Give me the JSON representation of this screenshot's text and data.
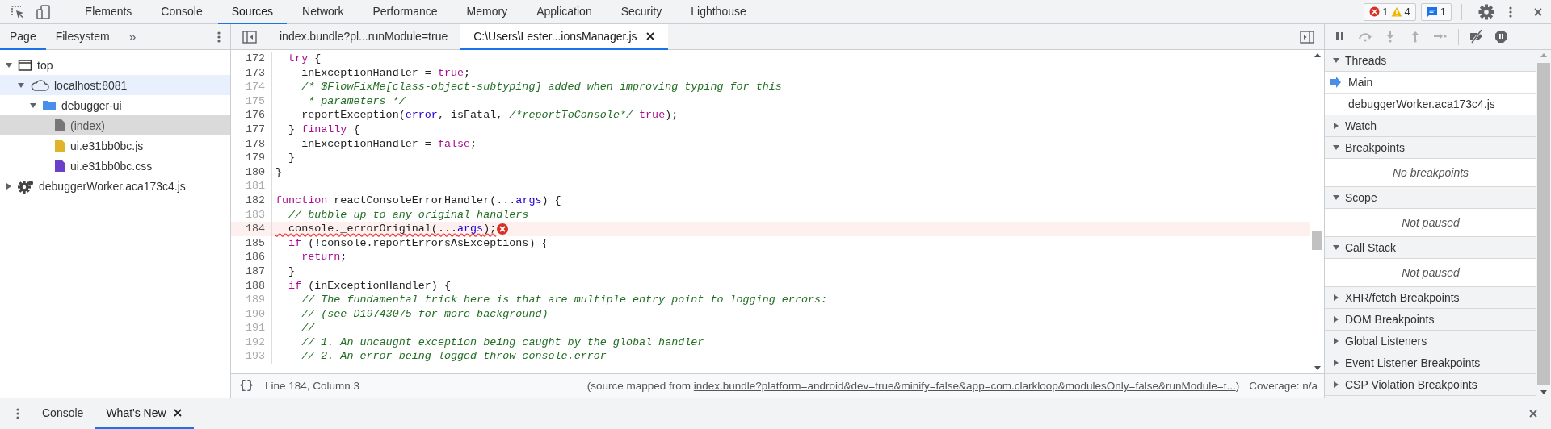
{
  "main_tabs": [
    {
      "label": "Elements",
      "selected": false
    },
    {
      "label": "Console",
      "selected": false
    },
    {
      "label": "Sources",
      "selected": true
    },
    {
      "label": "Network",
      "selected": false
    },
    {
      "label": "Performance",
      "selected": false
    },
    {
      "label": "Memory",
      "selected": false
    },
    {
      "label": "Application",
      "selected": false
    },
    {
      "label": "Security",
      "selected": false
    },
    {
      "label": "Lighthouse",
      "selected": false
    }
  ],
  "issue_counters": {
    "errors": "1",
    "warnings": "4",
    "messages": "1"
  },
  "navigator": {
    "tabs": [
      {
        "label": "Page",
        "selected": true
      },
      {
        "label": "Filesystem",
        "selected": false
      }
    ],
    "more": "»",
    "tree": [
      {
        "label": "top",
        "kind": "frame",
        "expanded": true,
        "selected": false,
        "hovered": false,
        "children": [
          {
            "label": "localhost:8081",
            "kind": "cloud",
            "expanded": true,
            "selected": false,
            "hovered": true,
            "children": [
              {
                "label": "debugger-ui",
                "kind": "folder",
                "expanded": true,
                "selected": false,
                "hovered": false,
                "children": [
                  {
                    "label": "(index)",
                    "kind": "document",
                    "selected": true,
                    "hovered": false
                  },
                  {
                    "label": "ui.e31bb0bc.js",
                    "kind": "script",
                    "selected": false,
                    "hovered": false
                  },
                  {
                    "label": "ui.e31bb0bc.css",
                    "kind": "stylesheet",
                    "selected": false,
                    "hovered": false
                  }
                ]
              }
            ]
          }
        ]
      },
      {
        "label": "debuggerWorker.aca173c4.js",
        "kind": "worker",
        "expanded": false,
        "selected": false,
        "hovered": false
      }
    ]
  },
  "editor": {
    "tabs": [
      {
        "label": "index.bundle?pl...runModule=true",
        "selected": false,
        "closable": false
      },
      {
        "label": "C:\\Users\\Lester...ionsManager.js",
        "selected": true,
        "closable": true
      }
    ],
    "lines": [
      {
        "number": "172",
        "dim": false,
        "error": false,
        "segments": [
          {
            "kind": "keyword",
            "t": "  try"
          },
          {
            "kind": "plain",
            "t": " {"
          }
        ]
      },
      {
        "number": "173",
        "dim": false,
        "error": false,
        "segments": [
          {
            "kind": "plain",
            "t": "    inExceptionHandler = "
          },
          {
            "kind": "keyword",
            "t": "true"
          },
          {
            "kind": "plain",
            "t": ";"
          }
        ]
      },
      {
        "number": "174",
        "dim": true,
        "error": false,
        "segments": [
          {
            "kind": "comment",
            "t": "    /* $FlowFixMe[class-object-subtyping] added when improving typing for this"
          }
        ]
      },
      {
        "number": "175",
        "dim": true,
        "error": false,
        "segments": [
          {
            "kind": "comment",
            "t": "     * parameters */"
          }
        ]
      },
      {
        "number": "176",
        "dim": false,
        "error": false,
        "segments": [
          {
            "kind": "plain",
            "t": "    reportException("
          },
          {
            "kind": "variable",
            "t": "error"
          },
          {
            "kind": "plain",
            "t": ", isFatal, "
          },
          {
            "kind": "comment",
            "t": "/*reportToConsole*/"
          },
          {
            "kind": "keyword",
            "t": " true"
          },
          {
            "kind": "plain",
            "t": ");"
          }
        ]
      },
      {
        "number": "177",
        "dim": false,
        "error": false,
        "segments": [
          {
            "kind": "plain",
            "t": "  } "
          },
          {
            "kind": "keyword",
            "t": "finally"
          },
          {
            "kind": "plain",
            "t": " {"
          }
        ]
      },
      {
        "number": "178",
        "dim": false,
        "error": false,
        "segments": [
          {
            "kind": "plain",
            "t": "    inExceptionHandler = "
          },
          {
            "kind": "keyword",
            "t": "false"
          },
          {
            "kind": "plain",
            "t": ";"
          }
        ]
      },
      {
        "number": "179",
        "dim": false,
        "error": false,
        "segments": [
          {
            "kind": "plain",
            "t": "  }"
          }
        ]
      },
      {
        "number": "180",
        "dim": false,
        "error": false,
        "segments": [
          {
            "kind": "plain",
            "t": "}"
          }
        ]
      },
      {
        "number": "181",
        "dim": true,
        "error": false
      },
      {
        "number": "182",
        "dim": false,
        "error": false,
        "segments": [
          {
            "kind": "keyword",
            "t": "function"
          },
          {
            "kind": "plain",
            "t": " reactConsoleErrorHandler(..."
          },
          {
            "kind": "variable",
            "t": "args"
          },
          {
            "kind": "plain",
            "t": ") {"
          }
        ]
      },
      {
        "number": "183",
        "dim": true,
        "error": false,
        "segments": [
          {
            "kind": "comment",
            "t": "  // bubble up to any original handlers"
          }
        ]
      },
      {
        "number": "184",
        "dim": false,
        "error": true,
        "segments": [
          {
            "kind": "plain",
            "t": "  console._errorOriginal(..."
          },
          {
            "kind": "variable",
            "t": "args"
          },
          {
            "kind": "plain",
            "t": ");"
          }
        ]
      },
      {
        "number": "185",
        "dim": false,
        "error": false,
        "segments": [
          {
            "kind": "keyword",
            "t": "  if"
          },
          {
            "kind": "plain",
            "t": " (!console.reportErrorsAsExceptions) {"
          }
        ]
      },
      {
        "number": "186",
        "dim": false,
        "error": false,
        "segments": [
          {
            "kind": "keyword",
            "t": "    return"
          },
          {
            "kind": "plain",
            "t": ";"
          }
        ]
      },
      {
        "number": "187",
        "dim": false,
        "error": false,
        "segments": [
          {
            "kind": "plain",
            "t": "  }"
          }
        ]
      },
      {
        "number": "188",
        "dim": false,
        "error": false,
        "segments": [
          {
            "kind": "keyword",
            "t": "  if"
          },
          {
            "kind": "plain",
            "t": " (inExceptionHandler) {"
          }
        ]
      },
      {
        "number": "189",
        "dim": true,
        "error": false,
        "segments": [
          {
            "kind": "comment",
            "t": "    // The fundamental trick here is that are multiple entry point to logging errors:"
          }
        ]
      },
      {
        "number": "190",
        "dim": true,
        "error": false,
        "segments": [
          {
            "kind": "comment",
            "t": "    // (see D19743075 for more background)"
          }
        ]
      },
      {
        "number": "191",
        "dim": true,
        "error": false,
        "segments": [
          {
            "kind": "comment",
            "t": "    //"
          }
        ]
      },
      {
        "number": "192",
        "dim": true,
        "error": false,
        "segments": [
          {
            "kind": "comment",
            "t": "    // 1. An uncaught exception being caught by the global handler"
          }
        ]
      },
      {
        "number": "193",
        "dim": true,
        "error": false,
        "segments": [
          {
            "kind": "comment",
            "t": "    // 2. An error being logged throw console.error"
          }
        ]
      }
    ]
  },
  "status_bar": {
    "pretty_print": "{}",
    "position": "Line 184, Column 3",
    "source_prefix": "(source mapped from ",
    "source_link": "index.bundle?platform=android&dev=true&minify=false&app=com.clarkloop&modulesOnly=false&runModule=t...",
    "source_suffix": ")",
    "coverage": "Coverage: n/a"
  },
  "debugger": {
    "controls": [
      {
        "kind": "pause",
        "disabled": false
      },
      {
        "kind": "step-over",
        "disabled": true
      },
      {
        "kind": "step-into",
        "disabled": true
      },
      {
        "kind": "step-out",
        "disabled": true
      },
      {
        "kind": "step",
        "disabled": true
      },
      {
        "kind": "deactivate-breakpoints",
        "disabled": false
      },
      {
        "kind": "pause-on-exceptions",
        "disabled": false
      }
    ],
    "sections": [
      {
        "title": "Threads",
        "expanded": true,
        "items": [
          {
            "label": "Main",
            "current": true
          },
          {
            "label": "debuggerWorker.aca173c4.js",
            "current": false
          }
        ]
      },
      {
        "title": "Watch",
        "expanded": false
      },
      {
        "title": "Breakpoints",
        "expanded": true,
        "message": "No breakpoints"
      },
      {
        "title": "Scope",
        "expanded": true,
        "message": "Not paused"
      },
      {
        "title": "Call Stack",
        "expanded": true,
        "message": "Not paused"
      },
      {
        "title": "XHR/fetch Breakpoints",
        "expanded": false
      },
      {
        "title": "DOM Breakpoints",
        "expanded": false
      },
      {
        "title": "Global Listeners",
        "expanded": false
      },
      {
        "title": "Event Listener Breakpoints",
        "expanded": false
      },
      {
        "title": "CSP Violation Breakpoints",
        "expanded": false
      }
    ]
  },
  "drawer": {
    "tabs": [
      {
        "label": "Console",
        "selected": false,
        "closable": false
      },
      {
        "label": "What's New",
        "selected": true,
        "closable": true
      }
    ]
  }
}
